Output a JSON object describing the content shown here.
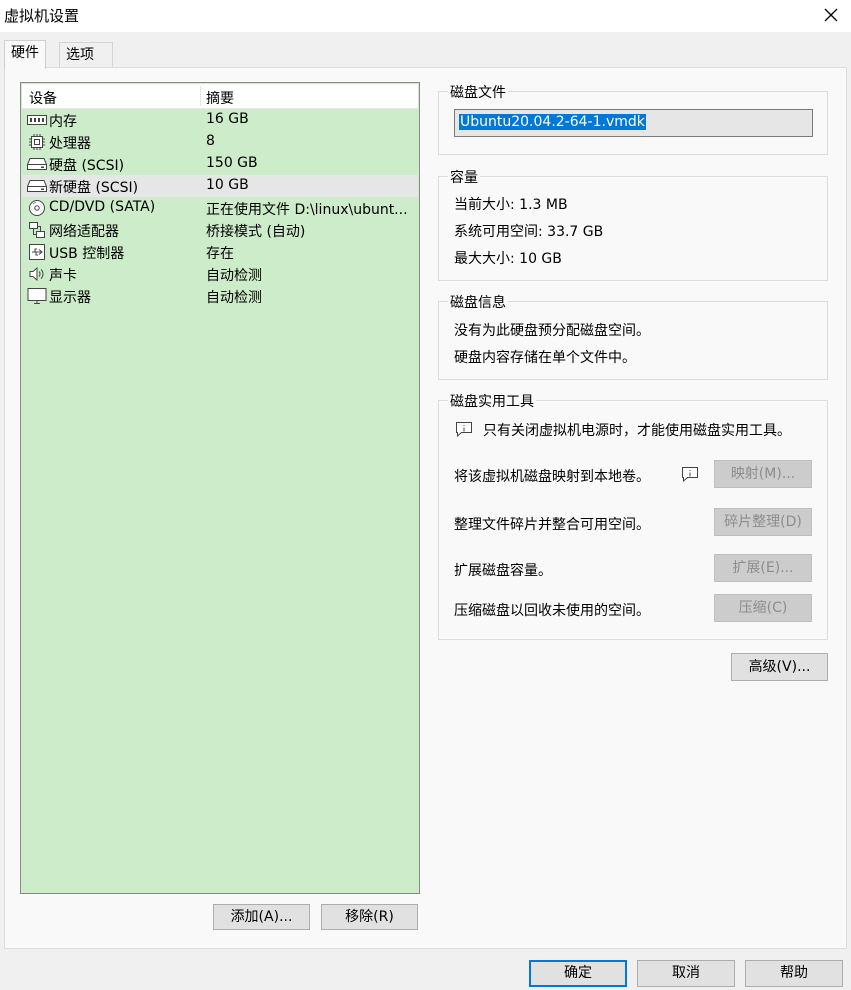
{
  "window": {
    "title": "虚拟机设置"
  },
  "tabs": [
    {
      "label": "硬件"
    },
    {
      "label": "选项"
    }
  ],
  "device_list": {
    "headers": {
      "device": "设备",
      "summary": "摘要"
    },
    "rows": [
      {
        "name": "内存",
        "summary": "16 GB",
        "icon": "memory-icon"
      },
      {
        "name": "处理器",
        "summary": "8",
        "icon": "cpu-icon"
      },
      {
        "name": "硬盘 (SCSI)",
        "summary": "150 GB",
        "icon": "hard-disk-icon"
      },
      {
        "name": "新硬盘 (SCSI)",
        "summary": "10 GB",
        "icon": "hard-disk-icon",
        "selected": true
      },
      {
        "name": "CD/DVD (SATA)",
        "summary": "正在使用文件 D:\\linux\\ubunt...",
        "icon": "cd-dvd-icon"
      },
      {
        "name": "网络适配器",
        "summary": "桥接模式 (自动)",
        "icon": "network-adapter-icon"
      },
      {
        "name": "USB 控制器",
        "summary": "存在",
        "icon": "usb-icon"
      },
      {
        "name": "声卡",
        "summary": "自动检测",
        "icon": "speaker-icon"
      },
      {
        "name": "显示器",
        "summary": "自动检测",
        "icon": "monitor-icon"
      }
    ],
    "add_button": "添加(A)...",
    "remove_button": "移除(R)"
  },
  "disk_file": {
    "label": "磁盘文件",
    "value": "Ubuntu20.04.2-64-1.vmdk"
  },
  "capacity": {
    "label": "容量",
    "current_size": "当前大小: 1.3 MB",
    "system_free": "系统可用空间: 33.7 GB",
    "max_size": "最大大小: 10 GB"
  },
  "disk_info": {
    "label": "磁盘信息",
    "line1": "没有为此硬盘预分配磁盘空间。",
    "line2": "硬盘内容存储在单个文件中。"
  },
  "utilities": {
    "label": "磁盘实用工具",
    "notice": "只有关闭虚拟机电源时，才能使用磁盘实用工具。",
    "map_text": "将该虚拟机磁盘映射到本地卷。",
    "map_button": "映射(M)...",
    "defrag_text": "整理文件碎片并整合可用空间。",
    "defrag_button": "碎片整理(D)",
    "expand_text": "扩展磁盘容量。",
    "expand_button": "扩展(E)...",
    "compact_text": "压缩磁盘以回收未使用的空间。",
    "compact_button": "压缩(C)"
  },
  "advanced_button": "高级(V)...",
  "footer": {
    "ok": "确定",
    "cancel": "取消",
    "help": "帮助"
  },
  "colors": {
    "device_list_bg": "#cdecc9",
    "accent": "#0078d7"
  }
}
